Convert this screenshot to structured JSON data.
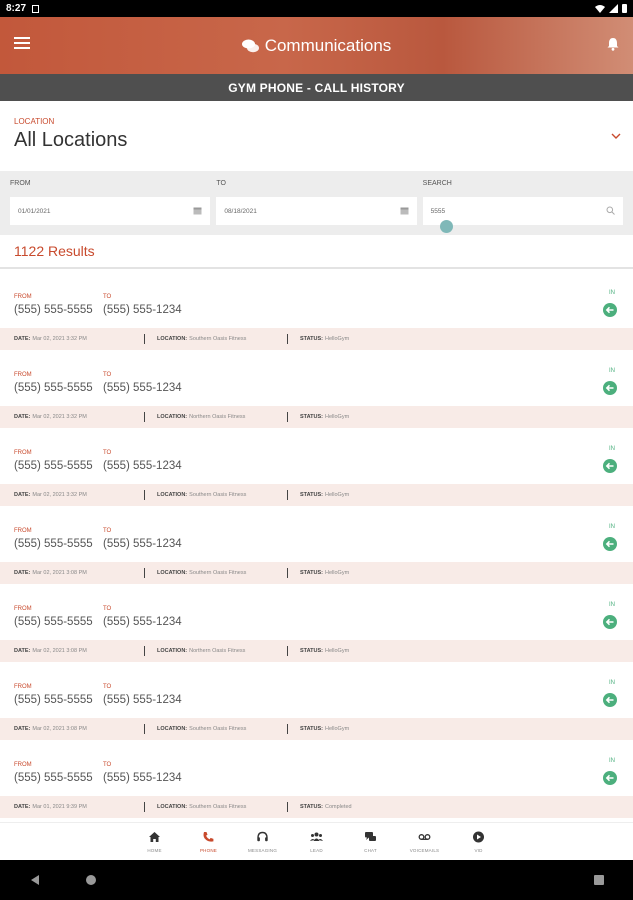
{
  "status_bar": {
    "time": "8:27"
  },
  "header": {
    "title": "Communications"
  },
  "subheader": {
    "title": "GYM PHONE - CALL HISTORY"
  },
  "location": {
    "label": "LOCATION",
    "value": "All Locations"
  },
  "filters": {
    "from": {
      "label": "FROM",
      "value": "01/01/2021"
    },
    "to": {
      "label": "TO",
      "value": "08/18/2021"
    },
    "search": {
      "label": "SEARCH",
      "value": "5555"
    }
  },
  "results": {
    "text": "1122 Results"
  },
  "labels": {
    "from": "FROM",
    "to": "TO",
    "date": "DATE:",
    "location": "LOCATION:",
    "status": "STATUS:"
  },
  "calls": [
    {
      "from": "(555) 555-5555",
      "to": "(555) 555-1234",
      "direction": "IN",
      "date": "Mar 02, 2021 3:32 PM",
      "location": "Southern Oasis Fitness",
      "status": "HelloGym"
    },
    {
      "from": "(555) 555-5555",
      "to": "(555) 555-1234",
      "direction": "IN",
      "date": "Mar 02, 2021 3:32 PM",
      "location": "Northern Oasis Fitness",
      "status": "HelloGym"
    },
    {
      "from": "(555) 555-5555",
      "to": "(555) 555-1234",
      "direction": "IN",
      "date": "Mar 02, 2021 3:32 PM",
      "location": "Southern Oasis Fitness",
      "status": "HelloGym"
    },
    {
      "from": "(555) 555-5555",
      "to": "(555) 555-1234",
      "direction": "IN",
      "date": "Mar 02, 2021 3:08 PM",
      "location": "Southern Oasis Fitness",
      "status": "HelloGym"
    },
    {
      "from": "(555) 555-5555",
      "to": "(555) 555-1234",
      "direction": "IN",
      "date": "Mar 02, 2021 3:08 PM",
      "location": "Northern Oasis Fitness",
      "status": "HelloGym"
    },
    {
      "from": "(555) 555-5555",
      "to": "(555) 555-1234",
      "direction": "IN",
      "date": "Mar 02, 2021 3:08 PM",
      "location": "Southern Oasis Fitness",
      "status": "HelloGym"
    },
    {
      "from": "(555) 555-5555",
      "to": "(555) 555-1234",
      "direction": "IN",
      "date": "Mar 01, 2021 9:39 PM",
      "location": "Southern Oasis Fitness",
      "status": "Completed"
    }
  ],
  "nav": [
    {
      "label": "HOME",
      "icon": "home-icon"
    },
    {
      "label": "PHONE",
      "icon": "phone-icon",
      "active": true
    },
    {
      "label": "MESSAGING",
      "icon": "headset-icon"
    },
    {
      "label": "LEAD",
      "icon": "people-icon"
    },
    {
      "label": "CHAT",
      "icon": "chat-icon"
    },
    {
      "label": "VOICEMAILS",
      "icon": "voicemail-icon"
    },
    {
      "label": "VID",
      "icon": "play-icon"
    }
  ],
  "colors": {
    "accent": "#c84a2d",
    "in_green": "#4caf7d",
    "meta_bg": "#f8ebe7",
    "subheader_bg": "#4f4f4f"
  }
}
